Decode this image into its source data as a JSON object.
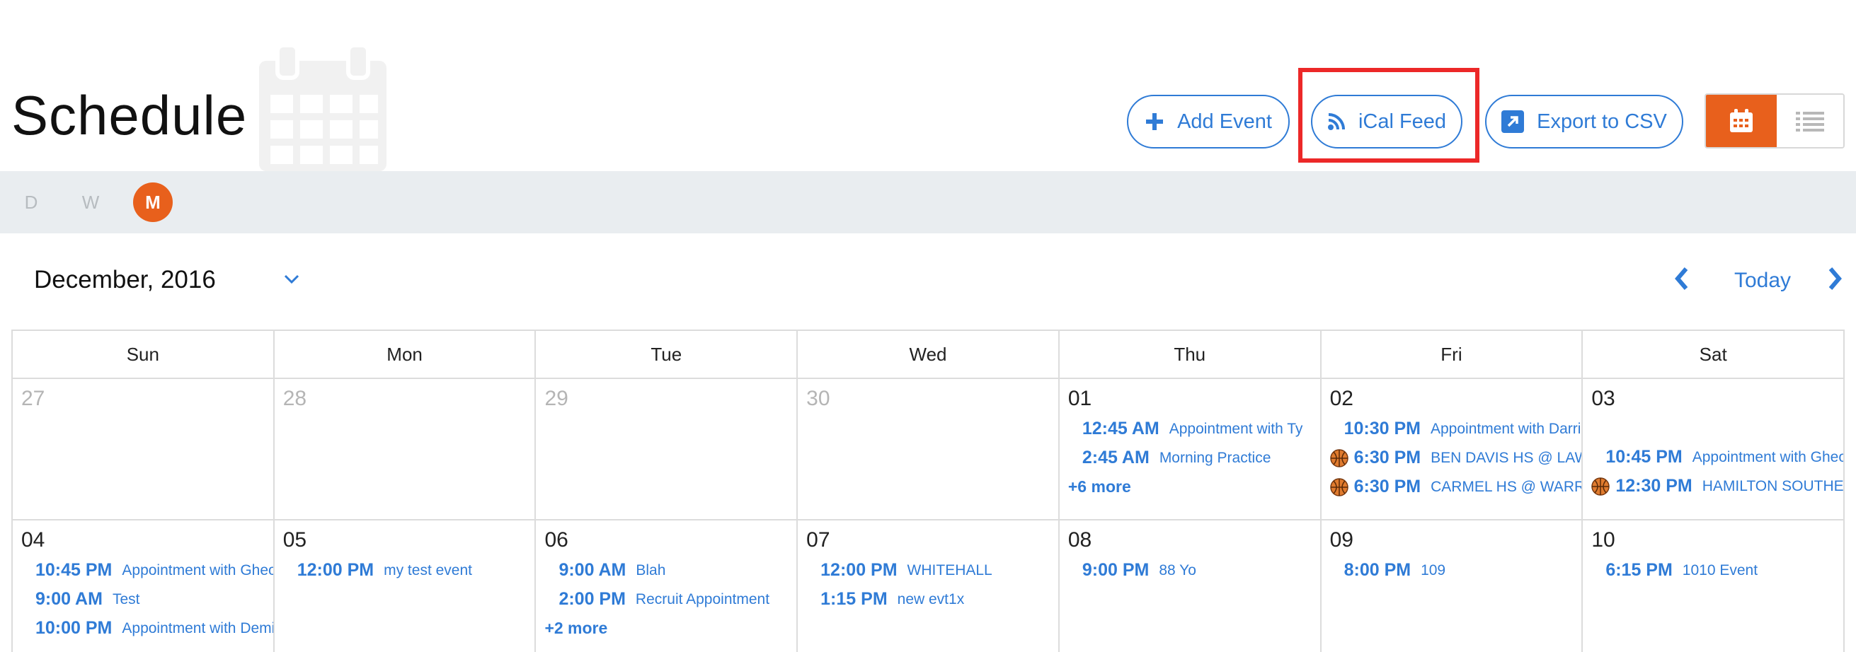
{
  "header": {
    "title": "Schedule",
    "buttons": {
      "add_event": "Add Event",
      "ical_feed": "iCal Feed",
      "export_csv": "Export to CSV"
    },
    "view_toggle": {
      "active": "calendar",
      "accent": "#e8601c"
    }
  },
  "modes": {
    "day": "D",
    "week": "W",
    "month": "M",
    "active": "M"
  },
  "nav": {
    "month_label": "December, 2016",
    "today": "Today"
  },
  "calendar": {
    "days_of_week": [
      "Sun",
      "Mon",
      "Tue",
      "Wed",
      "Thu",
      "Fri",
      "Sat"
    ],
    "weeks": [
      [
        {
          "day": "27",
          "muted": true,
          "events": []
        },
        {
          "day": "28",
          "muted": true,
          "events": []
        },
        {
          "day": "29",
          "muted": true,
          "events": []
        },
        {
          "day": "30",
          "muted": true,
          "events": []
        },
        {
          "day": "01",
          "muted": false,
          "events": [
            {
              "time": "12:45 AM",
              "name": "Appointment with Ty"
            },
            {
              "time": "2:45 AM",
              "name": "Morning Practice"
            }
          ],
          "more": "+6 more"
        },
        {
          "day": "02",
          "muted": false,
          "events": [
            {
              "time": "10:30 PM",
              "name": "Appointment with Darrione"
            },
            {
              "time": "6:30 PM",
              "name": "BEN DAVIS HS @ LAWRENCE",
              "icon": "basketball-icon"
            },
            {
              "time": "6:30 PM",
              "name": "CARMEL HS @ WARREN CENTRAL",
              "icon": "basketball-icon"
            }
          ]
        },
        {
          "day": "03",
          "muted": false,
          "offset_first": true,
          "events": [
            {
              "time": "10:45 PM",
              "name": "Appointment with Gheorghe"
            },
            {
              "time": "12:30 PM",
              "name": "HAMILTON SOUTHEASTERN",
              "icon": "basketball-icon"
            }
          ]
        }
      ],
      [
        {
          "day": "04",
          "muted": false,
          "events": [
            {
              "time": "10:45 PM",
              "name": "Appointment with Gheorghe"
            },
            {
              "time": "9:00 AM",
              "name": "Test"
            },
            {
              "time": "10:00 PM",
              "name": "Appointment with Demi"
            }
          ]
        },
        {
          "day": "05",
          "muted": false,
          "events": [
            {
              "time": "12:00 PM",
              "name": "my test event"
            }
          ]
        },
        {
          "day": "06",
          "muted": false,
          "events": [
            {
              "time": "9:00 AM",
              "name": "Blah"
            },
            {
              "time": "2:00 PM",
              "name": "Recruit Appointment"
            }
          ],
          "more": "+2 more"
        },
        {
          "day": "07",
          "muted": false,
          "events": [
            {
              "time": "12:00 PM",
              "name": "WHITEHALL"
            },
            {
              "time": "1:15 PM",
              "name": "new evt1x"
            }
          ]
        },
        {
          "day": "08",
          "muted": false,
          "events": [
            {
              "time": "9:00 PM",
              "name": "88 Yo"
            }
          ]
        },
        {
          "day": "09",
          "muted": false,
          "events": [
            {
              "time": "8:00 PM",
              "name": "109"
            }
          ]
        },
        {
          "day": "10",
          "muted": false,
          "events": [
            {
              "time": "6:15 PM",
              "name": "1010 Event"
            }
          ]
        }
      ]
    ]
  }
}
